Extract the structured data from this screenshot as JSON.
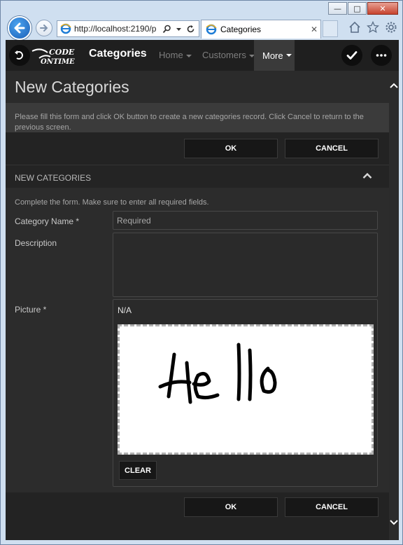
{
  "browser": {
    "address": "http://localhost:2190/p",
    "tab_title": "Categories"
  },
  "app": {
    "title": "Categories",
    "menu": {
      "home": "Home",
      "customers": "Customers",
      "more": "More"
    }
  },
  "page": {
    "title": "New Categories",
    "description": "Please fill this form and click OK button to create a new categories record. Click Cancel to return to the previous screen.",
    "ok_label": "OK",
    "cancel_label": "CANCEL"
  },
  "section": {
    "title": "NEW CATEGORIES",
    "hint": "Complete the form. Make sure to enter all required fields."
  },
  "fields": {
    "category_name": {
      "label": "Category Name *",
      "placeholder": "Required"
    },
    "description": {
      "label": "Description"
    },
    "picture": {
      "label": "Picture *",
      "value": "N/A",
      "clear_label": "CLEAR"
    }
  },
  "icons": {
    "back": "back-arrow-icon",
    "forward": "forward-arrow-icon",
    "search": "search-icon",
    "refresh": "refresh-icon",
    "home": "home-icon",
    "favorites": "star-icon",
    "settings": "gear-icon",
    "undo": "undo-icon",
    "check": "checkmark-icon",
    "more": "ellipsis-icon",
    "collapse": "chevron-up-icon"
  },
  "colors": {
    "app_background": "#2b2b2b",
    "bar_background": "#1f1f1f",
    "accent_text": "#ffffff"
  }
}
